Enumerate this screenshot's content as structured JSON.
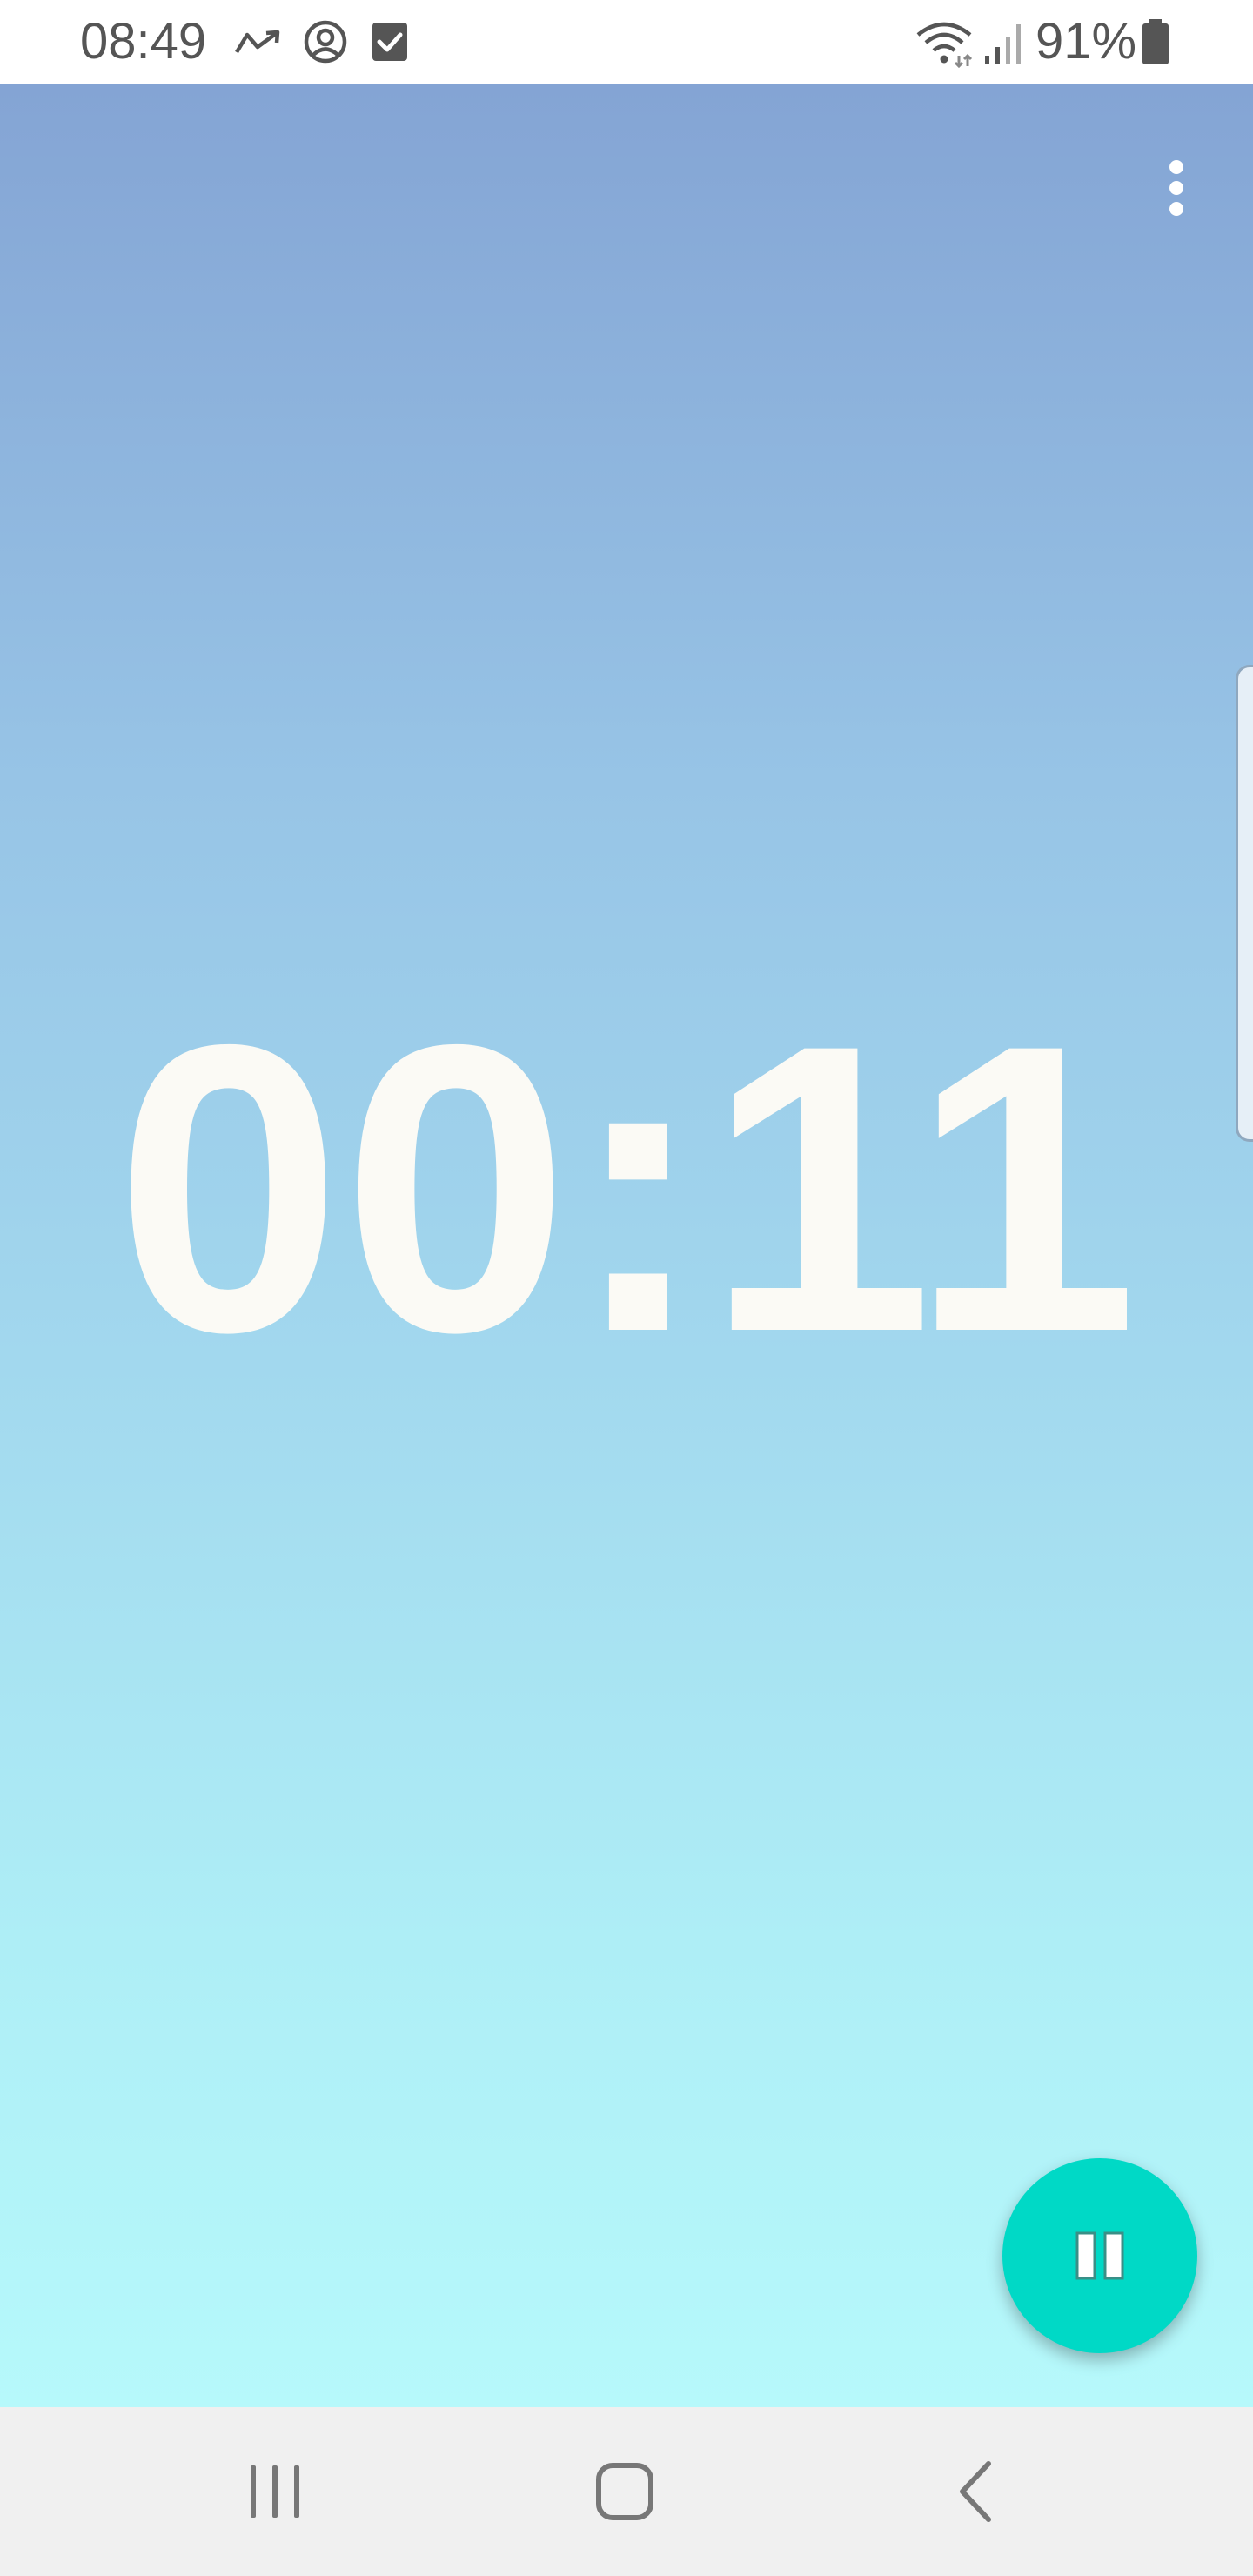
{
  "status_bar": {
    "time": "08:49",
    "battery_percent": "91%",
    "icons": [
      "missed-call-icon",
      "account-circle-icon",
      "checkbox-icon",
      "wifi-icon",
      "signal-icon",
      "battery-icon"
    ]
  },
  "stopwatch": {
    "elapsed": "00:11",
    "state": "running"
  },
  "toolbar": {
    "menu_icon": "more-vert-icon"
  },
  "fab": {
    "icon": "pause-icon",
    "color": "#00d9c6"
  },
  "navigation": {
    "buttons": [
      "recent-apps-icon",
      "home-icon",
      "back-icon"
    ]
  },
  "colors": {
    "gradient_top": "#84a4d4",
    "gradient_bottom": "#b6f9fb",
    "timer_text": "#fbfaf5",
    "accent": "#00d9c6"
  }
}
